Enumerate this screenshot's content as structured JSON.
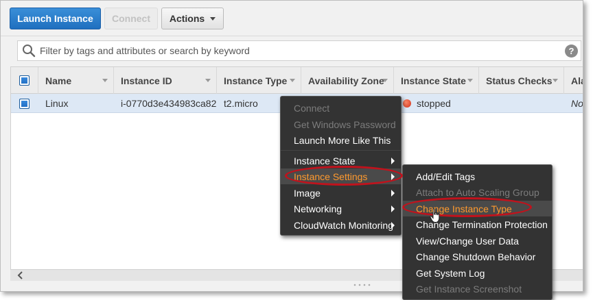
{
  "toolbar": {
    "launch_label": "Launch Instance",
    "connect_label": "Connect",
    "actions_label": "Actions"
  },
  "search": {
    "placeholder": "Filter by tags and attributes or search by keyword",
    "help_label": "?"
  },
  "table": {
    "columns": [
      "Name",
      "Instance ID",
      "Instance Type",
      "Availability Zone",
      "Instance State",
      "Status Checks",
      "Ala"
    ],
    "rows": [
      {
        "name": "Linux",
        "instance_id": "i-0770d3e434983ca82",
        "instance_type": "t2.micro",
        "instance_state": "stopped",
        "alarm": "Nor"
      }
    ]
  },
  "context_menu": {
    "items": [
      {
        "label": "Connect",
        "enabled": false
      },
      {
        "label": "Get Windows Password",
        "enabled": false
      },
      {
        "label": "Launch More Like This",
        "enabled": true
      },
      {
        "label": "Instance State",
        "enabled": true,
        "submenu": true
      },
      {
        "label": "Instance Settings",
        "enabled": true,
        "submenu": true,
        "active": true
      },
      {
        "label": "Image",
        "enabled": true,
        "submenu": true
      },
      {
        "label": "Networking",
        "enabled": true,
        "submenu": true
      },
      {
        "label": "CloudWatch Monitoring",
        "enabled": true,
        "submenu": true
      }
    ]
  },
  "submenu": {
    "items": [
      {
        "label": "Add/Edit Tags",
        "enabled": true
      },
      {
        "label": "Attach to Auto Scaling Group",
        "enabled": false
      },
      {
        "label": "Change Instance Type",
        "enabled": true,
        "active": true
      },
      {
        "label": "Change Termination Protection",
        "enabled": true
      },
      {
        "label": "View/Change User Data",
        "enabled": true
      },
      {
        "label": "Change Shutdown Behavior",
        "enabled": true
      },
      {
        "label": "Get System Log",
        "enabled": true
      },
      {
        "label": "Get Instance Screenshot",
        "enabled": false
      }
    ]
  },
  "colors": {
    "primary_button": "#1f6fbf",
    "menu_background": "#333333",
    "menu_highlight": "#ff9a2e",
    "annotation": "#c1121c",
    "selected_row": "#dde8f5",
    "stopped_status": "#d0301a"
  }
}
